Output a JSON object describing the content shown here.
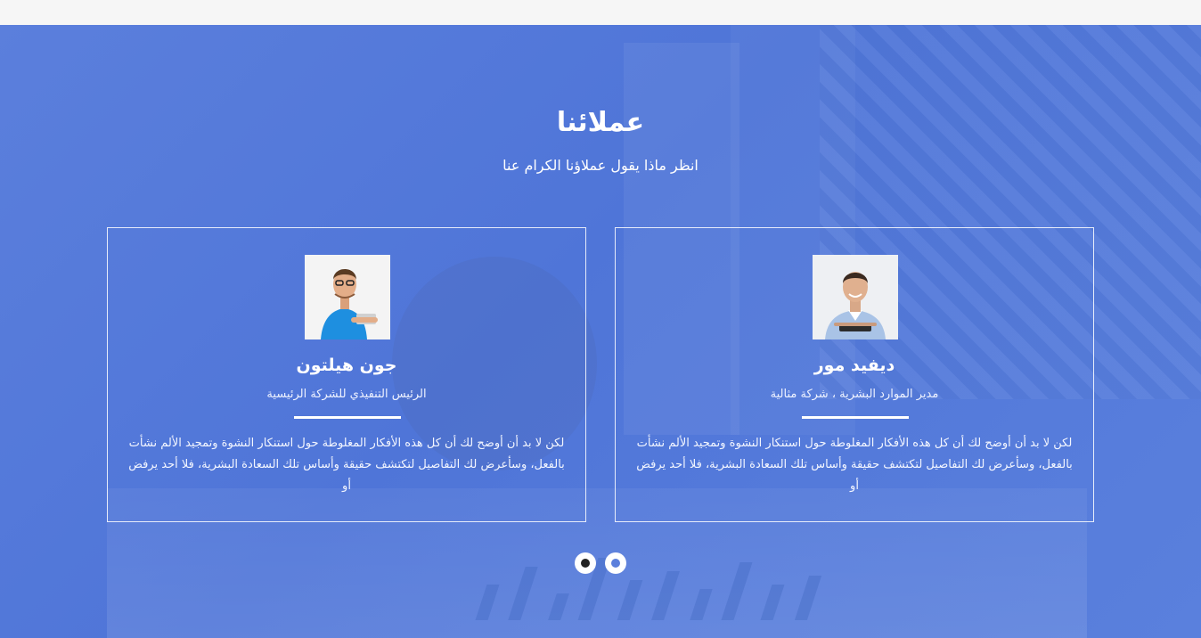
{
  "section": {
    "title": "عملائنا",
    "subtitle": "انظر ماذا يقول عملاؤنا الكرام عنا"
  },
  "testimonials": [
    {
      "name": "ديفيد مور",
      "role": "مدير الموارد البشرية ، شركة مثالية",
      "text": "لكن لا بد أن أوضح لك أن كل هذه الأفكار المغلوطة حول استنكار النشوة وتمجيد الألم نشأت بالفعل، وسأعرض لك التفاصيل لتكتشف حقيقة وأساس تلك السعادة البشرية، فلا أحد يرفض أو",
      "avatar_icon": "person-photo-icon"
    },
    {
      "name": "جون هيلتون",
      "role": "الرئيس التنفيذي للشركة الرئيسية",
      "text": "لكن لا بد أن أوضح لك أن كل هذه الأفكار المغلوطة حول استنكار النشوة وتمجيد الألم نشأت بالفعل، وسأعرض لك التفاصيل لتكتشف حقيقة وأساس تلك السعادة البشرية، فلا أحد يرفض أو",
      "avatar_icon": "person-photo-icon"
    }
  ],
  "carousel": {
    "active_index": 0,
    "page_count": 2
  },
  "colors": {
    "background": "#5b7fdc",
    "text": "#ffffff",
    "active_dot": "#222222"
  }
}
